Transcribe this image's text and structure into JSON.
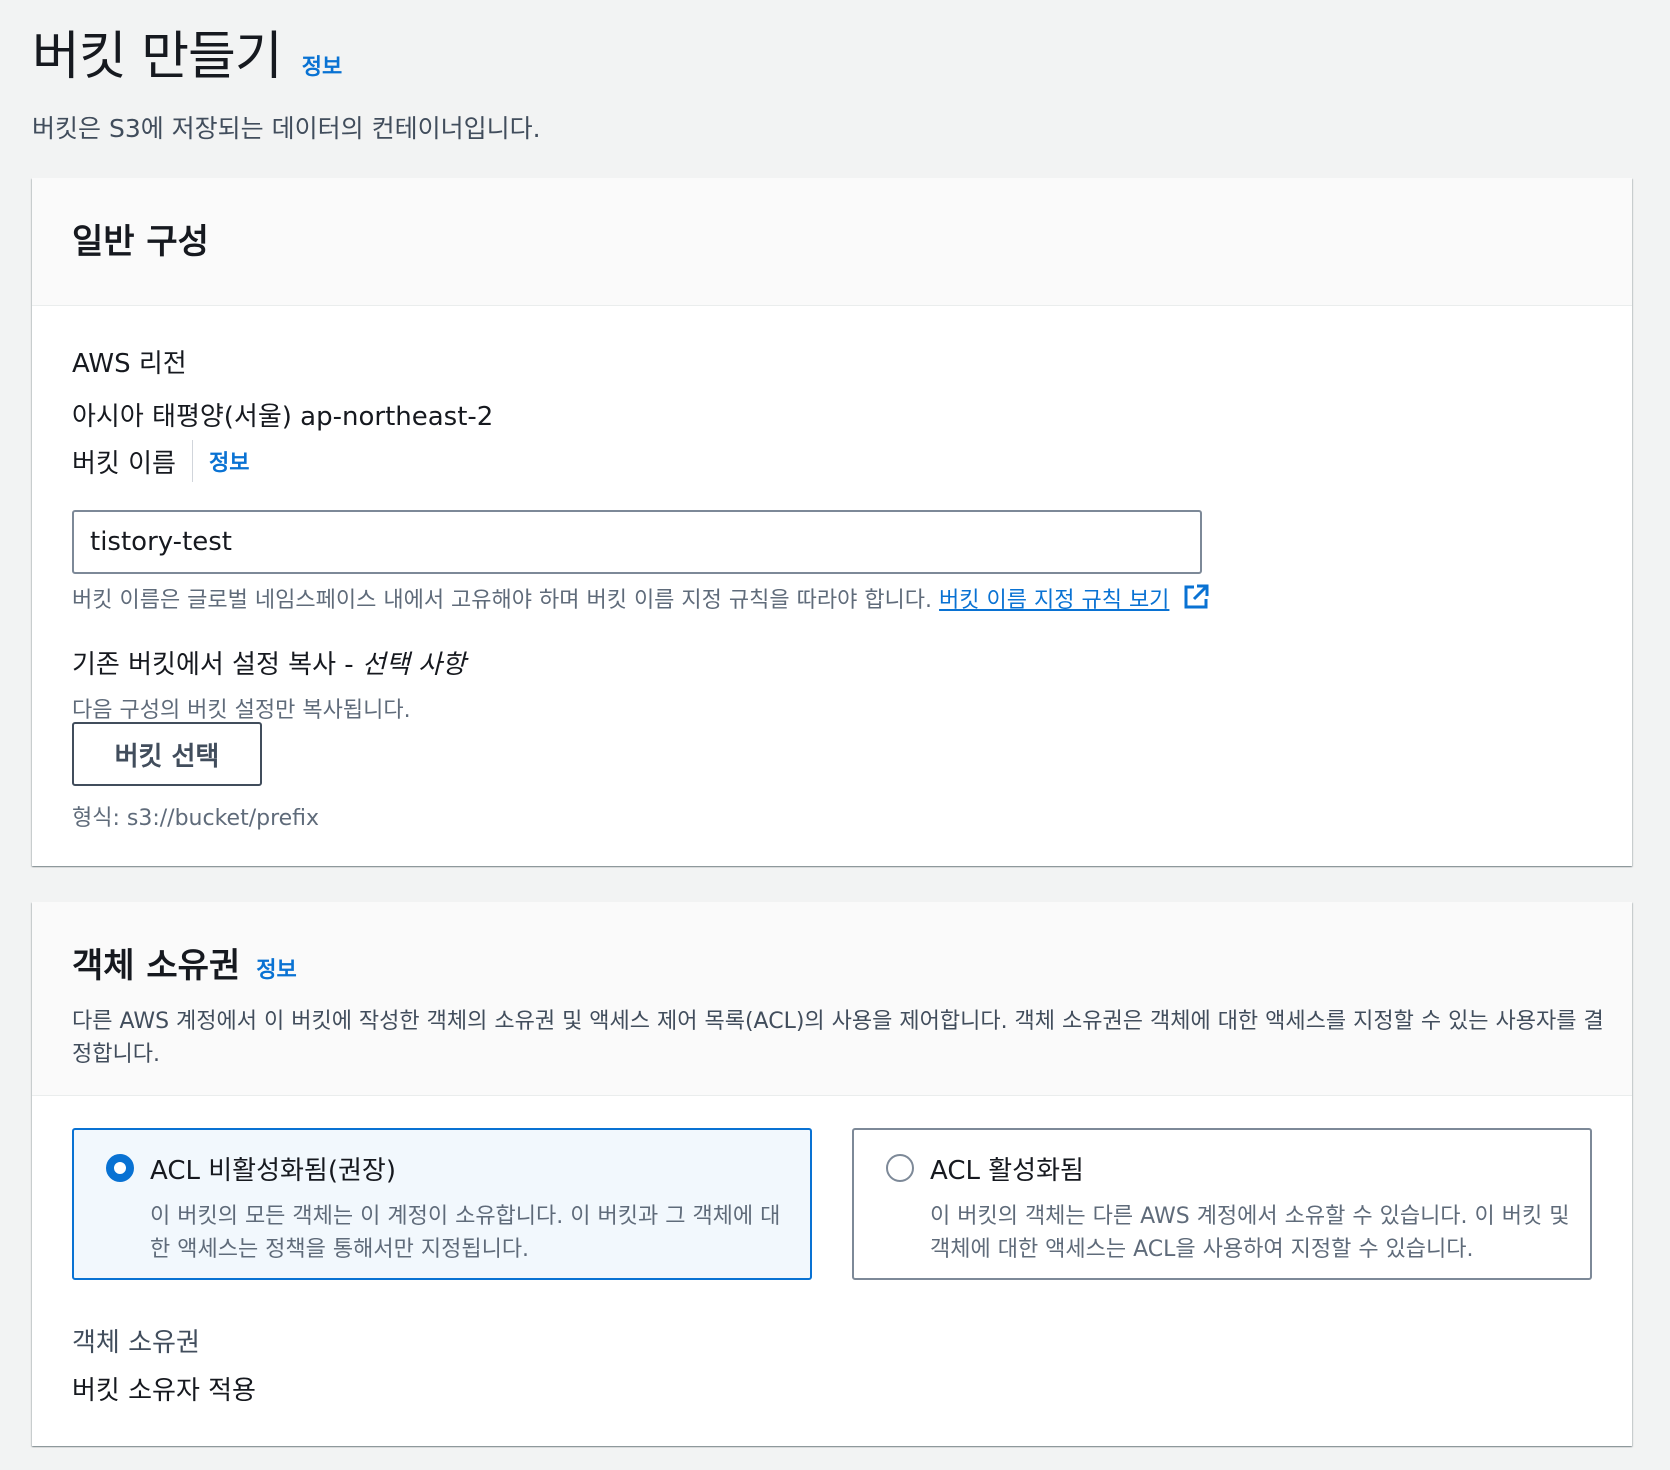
{
  "page": {
    "title": "버킷 만들기",
    "info": "정보",
    "description": "버킷은 S3에 저장되는 데이터의 컨테이너입니다."
  },
  "general": {
    "title": "일반 구성",
    "region_label": "AWS 리전",
    "region_value": "아시아 태평양(서울) ap-northeast-2",
    "bucket_name_label": "버킷 이름",
    "bucket_name_info": "정보",
    "bucket_name_value": "tistory-test",
    "bucket_name_hint": "버킷 이름은 글로벌 네임스페이스 내에서 고유해야 하며 버킷 이름 지정 규칙을 따라야 합니다.",
    "naming_rules_link": "버킷 이름 지정 규칙 보기",
    "copy_label": "기존 버킷에서 설정 복사 - ",
    "copy_optional": "선택 사항",
    "copy_hint": "다음 구성의 버킷 설정만 복사됩니다.",
    "choose_bucket_button": "버킷 선택",
    "format_hint": "형식: s3://bucket/prefix"
  },
  "ownership": {
    "title": "객체 소유권",
    "info": "정보",
    "description": "다른 AWS 계정에서 이 버킷에 작성한 객체의 소유권 및 액세스 제어 목록(ACL)의 사용을 제어합니다. 객체 소유권은 객체에 대한 액세스를 지정할 수 있는 사용자를 결정합니다.",
    "options": [
      {
        "title": "ACL 비활성화됨(권장)",
        "description": "이 버킷의 모든 객체는 이 계정이 소유합니다. 이 버킷과 그 객체에 대한 액세스는 정책을 통해서만 지정됩니다.",
        "selected": true
      },
      {
        "title": "ACL 활성화됨",
        "description": "이 버킷의 객체는 다른 AWS 계정에서 소유할 수 있습니다. 이 버킷 및 객체에 대한 액세스는 ACL을 사용하여 지정할 수 있습니다.",
        "selected": false
      }
    ],
    "result_label": "객체 소유권",
    "result_value": "버킷 소유자 적용"
  },
  "colors": {
    "link": "#0972d3",
    "selected_tile_bg": "#f2f8fd",
    "page_bg": "#f2f3f3"
  },
  "icons": {
    "external_link": "external-link-icon"
  }
}
